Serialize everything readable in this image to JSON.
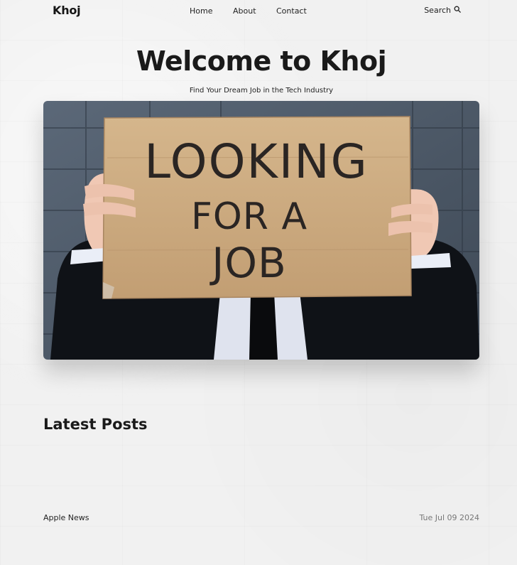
{
  "site": {
    "logo": "Khoj"
  },
  "nav": {
    "items": [
      {
        "label": "Home"
      },
      {
        "label": "About"
      },
      {
        "label": "Contact"
      }
    ],
    "search_label": "Search"
  },
  "hero": {
    "title": "Welcome to Khoj",
    "subtitle": "Find Your Dream Job in the Tech Industry",
    "image_sign_lines": [
      "LOOKING",
      "FOR A",
      "JOB"
    ]
  },
  "latest": {
    "heading": "Latest Posts",
    "posts": [
      {
        "title": "Apple News",
        "date": "Tue Jul 09 2024"
      }
    ]
  },
  "colors": {
    "text": "#1a1a1a",
    "muted": "#777777",
    "background": "#f1f1f1",
    "cardboard": "#c9a47a"
  }
}
